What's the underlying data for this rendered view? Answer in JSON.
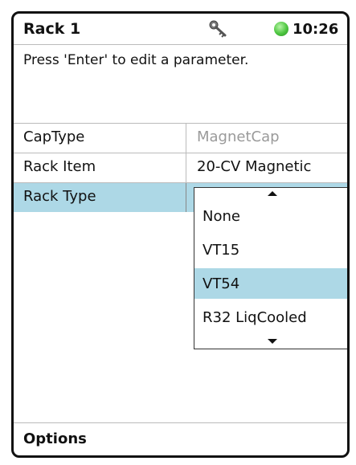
{
  "header": {
    "title": "Rack 1",
    "time": "10:26",
    "icons": [
      "key-icon",
      "status-online-icon"
    ]
  },
  "hint": "Press 'Enter' to edit a parameter.",
  "rows": [
    {
      "label": "CapType",
      "value": "MagnetCap"
    },
    {
      "label": "Rack Item",
      "value": "20-CV Magnetic"
    },
    {
      "label": "Rack Type",
      "value": ""
    }
  ],
  "dropdown": {
    "options": [
      "None",
      "VT15",
      "VT54",
      "R32 LiqCooled"
    ],
    "selected": "VT54"
  },
  "footer": {
    "options_label": "Options"
  },
  "colors": {
    "selection": "#add8e6",
    "status_green": "#4cc53f"
  }
}
